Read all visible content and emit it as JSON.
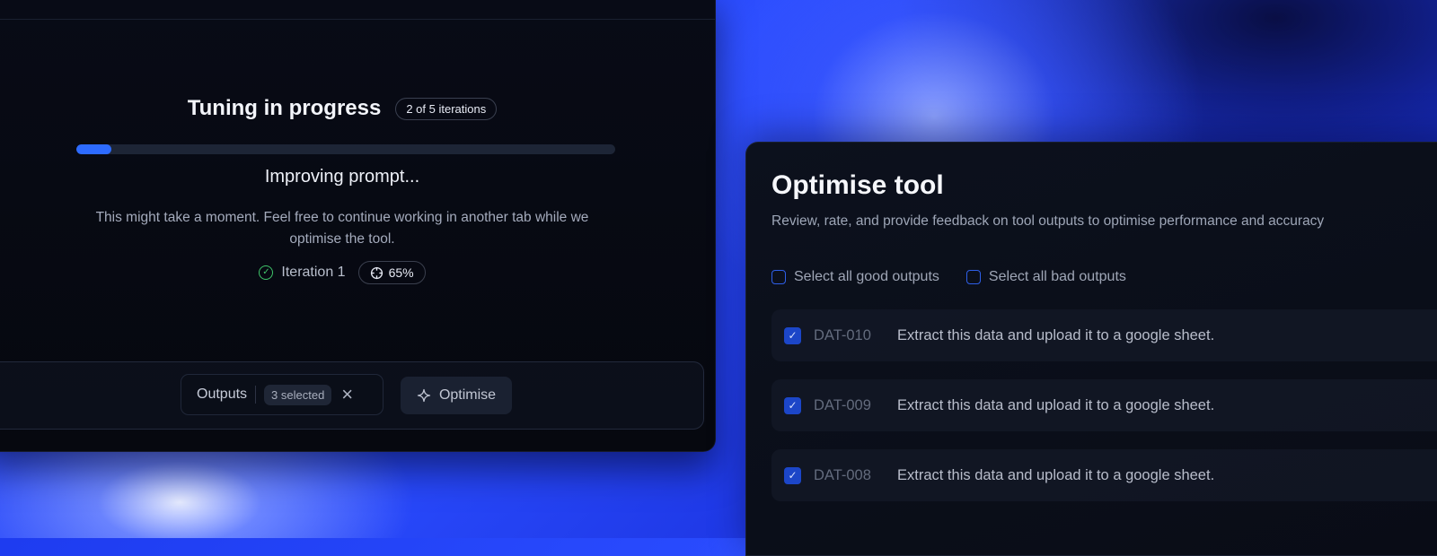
{
  "left_panel": {
    "heading": "Tuning in progress",
    "iterations_badge": "2 of 5 iterations",
    "progress_fraction": 0.065,
    "status": "Improving prompt...",
    "description": "This might take a moment. Feel free to continue working in another tab while we optimise the tool.",
    "iteration_label": "Iteration 1",
    "iteration_percent": "65%"
  },
  "bottom_bar": {
    "outputs_label": "Outputs",
    "selected_badge": "3 selected",
    "optimise_label": "Optimise"
  },
  "right_panel": {
    "title": "Optimise tool",
    "description": "Review, rate, and provide feedback on tool outputs to optimise performance and accuracy",
    "select_good": "Select all good outputs",
    "select_bad": "Select all bad outputs",
    "rows": [
      {
        "id": "DAT-010",
        "text": "Extract this data and upload it to a google sheet.",
        "checked": true
      },
      {
        "id": "DAT-009",
        "text": "Extract this data and upload it to a google sheet.",
        "checked": true
      },
      {
        "id": "DAT-008",
        "text": "Extract this data and upload it to a google sheet.",
        "checked": true
      }
    ]
  },
  "icons": {
    "check_circle": "check-circle-icon",
    "target": "target-icon",
    "close": "close-icon",
    "sparkle": "sparkle-icon",
    "checkbox_checked": "checkbox-checked-icon"
  },
  "colors": {
    "accent_blue": "#2d6bff",
    "success_green": "#3fc46a",
    "checkbox_blue": "#1c46c8"
  }
}
